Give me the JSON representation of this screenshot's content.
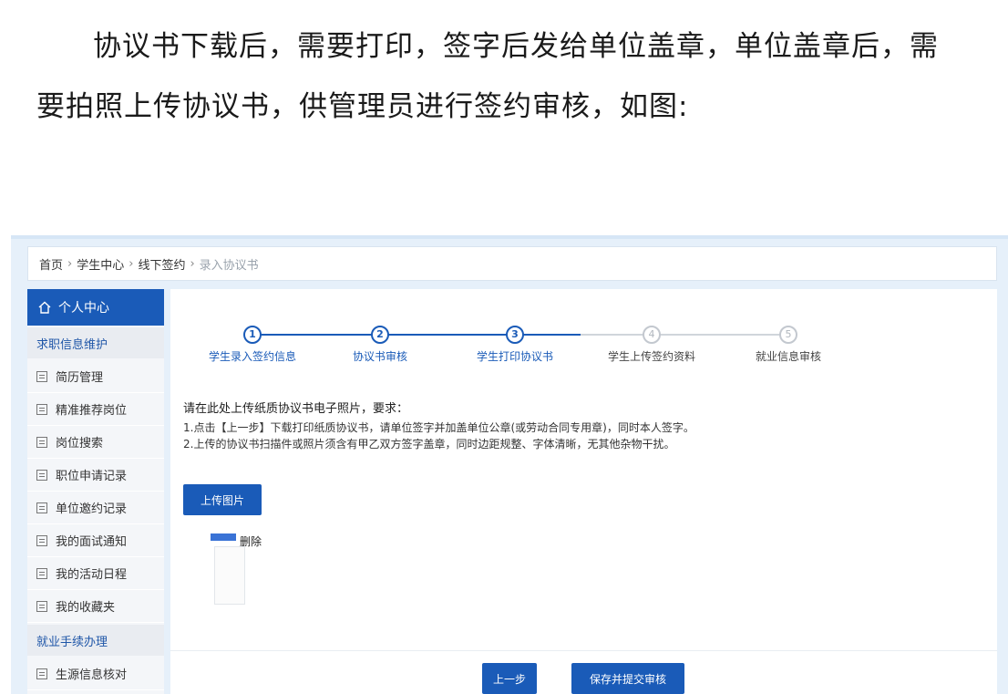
{
  "intro": {
    "text": "协议书下载后，需要打印，签字后发给单位盖章，单位盖章后，需要拍照上传协议书，供管理员进行签约审核，如图:"
  },
  "breadcrumb": {
    "items": [
      "首页",
      "学生中心",
      "线下签约",
      "录入协议书"
    ]
  },
  "sidebar": {
    "header": "个人中心",
    "group1": "求职信息维护",
    "items1": [
      "简历管理",
      "精准推荐岗位",
      "岗位搜索",
      "职位申请记录",
      "单位邀约记录",
      "我的面试通知",
      "我的活动日程",
      "我的收藏夹"
    ],
    "group2": "就业手续办理",
    "items2": [
      "生源信息核对"
    ]
  },
  "steps": [
    {
      "num": "1",
      "label": "学生录入签约信息",
      "done": true
    },
    {
      "num": "2",
      "label": "协议书审核",
      "done": true
    },
    {
      "num": "3",
      "label": "学生打印协议书",
      "done": true
    },
    {
      "num": "4",
      "label": "学生上传签约资料",
      "done": false
    },
    {
      "num": "5",
      "label": "就业信息审核",
      "done": false
    }
  ],
  "requirements": {
    "heading": "请在此处上传纸质协议书电子照片，要求：",
    "line1": "1.点击【上一步】下载打印纸质协议书，请单位签字并加盖单位公章(或劳动合同专用章)，同时本人签字。",
    "line2": "2.上传的协议书扫描件或照片须含有甲乙双方签字盖章，同时边距规整、字体清晰，无其他杂物干扰。"
  },
  "upload": {
    "button": "上传图片",
    "delete": "删除"
  },
  "actions": {
    "prev": "上一步",
    "save": "保存并提交审核"
  },
  "colors": {
    "primary": "#1a5bb8",
    "todo": "#c3c8cf"
  }
}
